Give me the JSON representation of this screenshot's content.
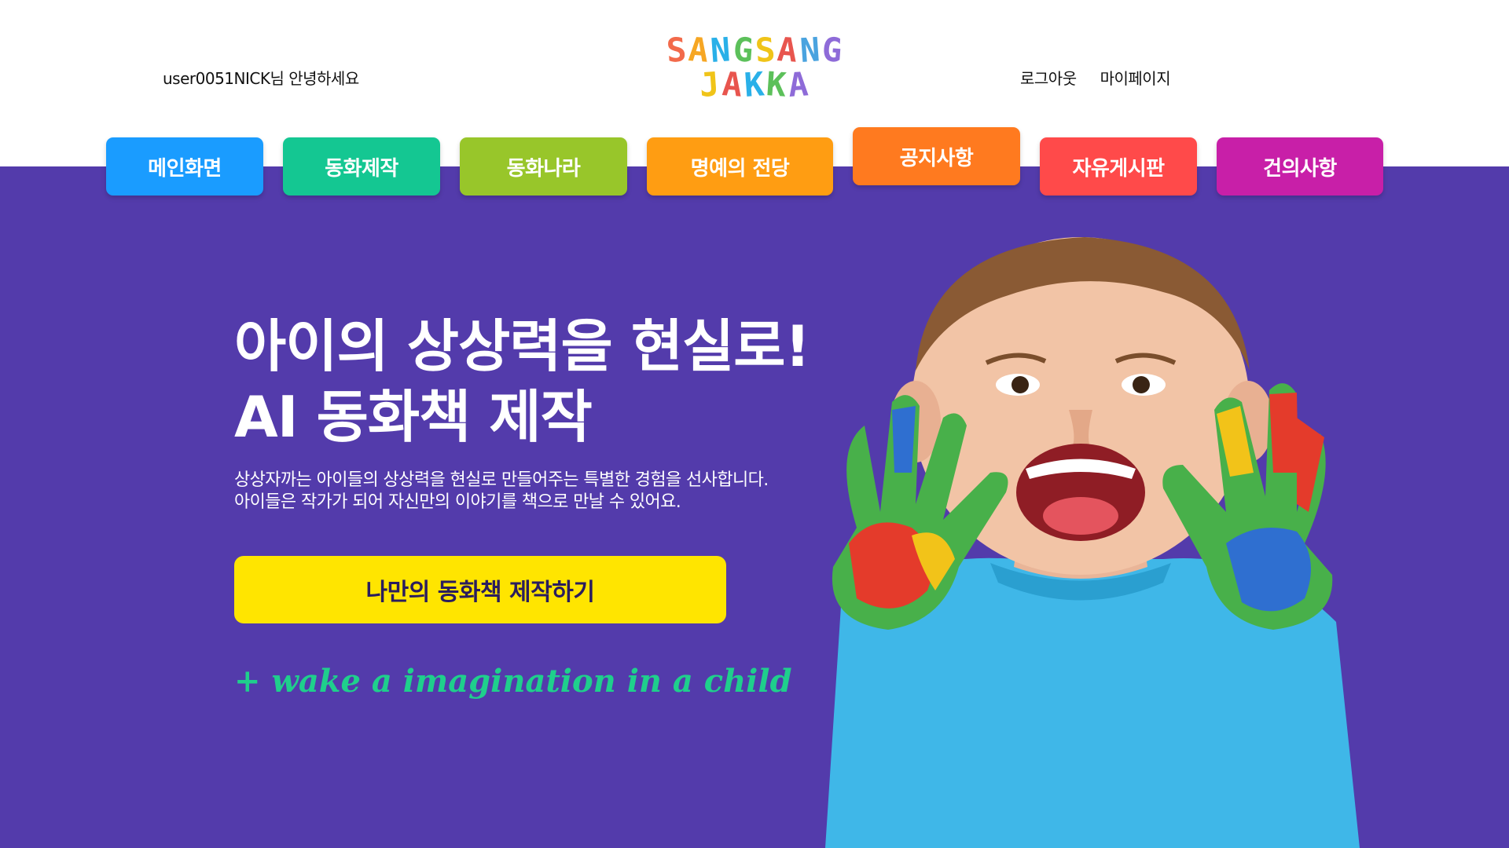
{
  "header": {
    "greeting": "user0051NICK님 안녕하세요",
    "logo": {
      "line1": [
        "S",
        "A",
        "N",
        "G",
        "S",
        "A",
        "N",
        "G"
      ],
      "line2": [
        "J",
        "A",
        "K",
        "K",
        "A"
      ],
      "colors1": [
        "#f26a4b",
        "#f6a623",
        "#2ab0e8",
        "#5cc05a",
        "#f0c419",
        "#e8554e",
        "#4aa3df",
        "#8e6bd8"
      ],
      "colors2": [
        "#f0c419",
        "#e8554e",
        "#2ab0e8",
        "#5cc05a",
        "#8e6bd8"
      ]
    },
    "links": {
      "logout": "로그아웃",
      "mypage": "마이페이지"
    }
  },
  "nav": {
    "items": [
      {
        "label": "메인화면",
        "color": "#1a9cff"
      },
      {
        "label": "동화제작",
        "color": "#14c792"
      },
      {
        "label": "동화나라",
        "color": "#98c62a"
      },
      {
        "label": "명예의 전당",
        "color": "#ff9d12"
      },
      {
        "label": "공지사항",
        "color": "#ff7a1f"
      },
      {
        "label": "자유게시판",
        "color": "#ff4a4a"
      },
      {
        "label": "건의사항",
        "color": "#c81fa8"
      }
    ]
  },
  "hero": {
    "title_line1": "아이의 상상력을 현실로!",
    "title_line2": "AI 동화책 제작",
    "desc_line1": "상상자까는 아이들의 상상력을 현실로 만들어주는 특별한 경험을 선사합니다.",
    "desc_line2": "아이들은 작가가 되어 자신만의 이야기를 책으로 만날 수 있어요.",
    "cta_label": "나만의 동화책 제작하기",
    "tagline": "+ wake a imagination in a child",
    "background": "#533bab",
    "cta_color": "#ffe500",
    "tagline_color": "#1fcf8c"
  }
}
